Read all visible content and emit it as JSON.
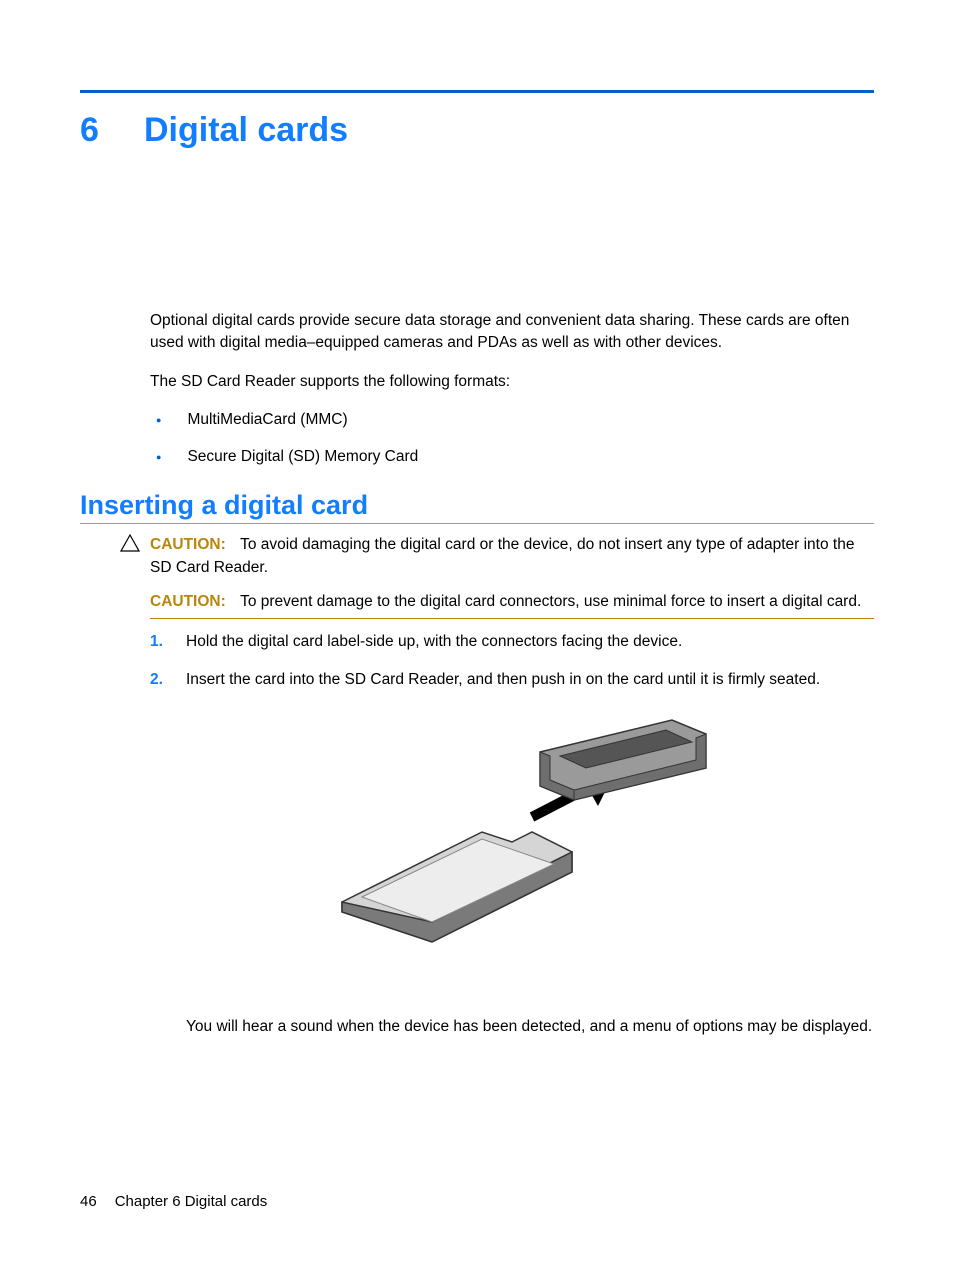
{
  "chapter": {
    "number": "6",
    "title": "Digital cards"
  },
  "intro": {
    "p1": "Optional digital cards provide secure data storage and convenient data sharing. These cards are often used with digital media–equipped cameras and PDAs as well as with other devices.",
    "p2": "The SD Card Reader supports the following formats:",
    "bullets": [
      "MultiMediaCard (MMC)",
      "Secure Digital (SD) Memory Card"
    ]
  },
  "section": {
    "heading": "Inserting a digital card",
    "caution1": {
      "label": "CAUTION:",
      "text": "To avoid damaging the digital card or the device, do not insert any type of adapter into the SD Card Reader."
    },
    "caution2": {
      "label": "CAUTION:",
      "text": "To prevent damage to the digital card connectors, use minimal force to insert a digital card."
    },
    "steps": [
      {
        "num": "1.",
        "text": "Hold the digital card label-side up, with the connectors facing the device."
      },
      {
        "num": "2.",
        "text": "Insert the card into the SD Card Reader, and then push in on the card until it is firmly seated."
      }
    ],
    "note": "You will hear a sound when the device has been detected, and a menu of options may be displayed."
  },
  "footer": {
    "page": "46",
    "chapter_label": "Chapter 6   Digital cards"
  }
}
